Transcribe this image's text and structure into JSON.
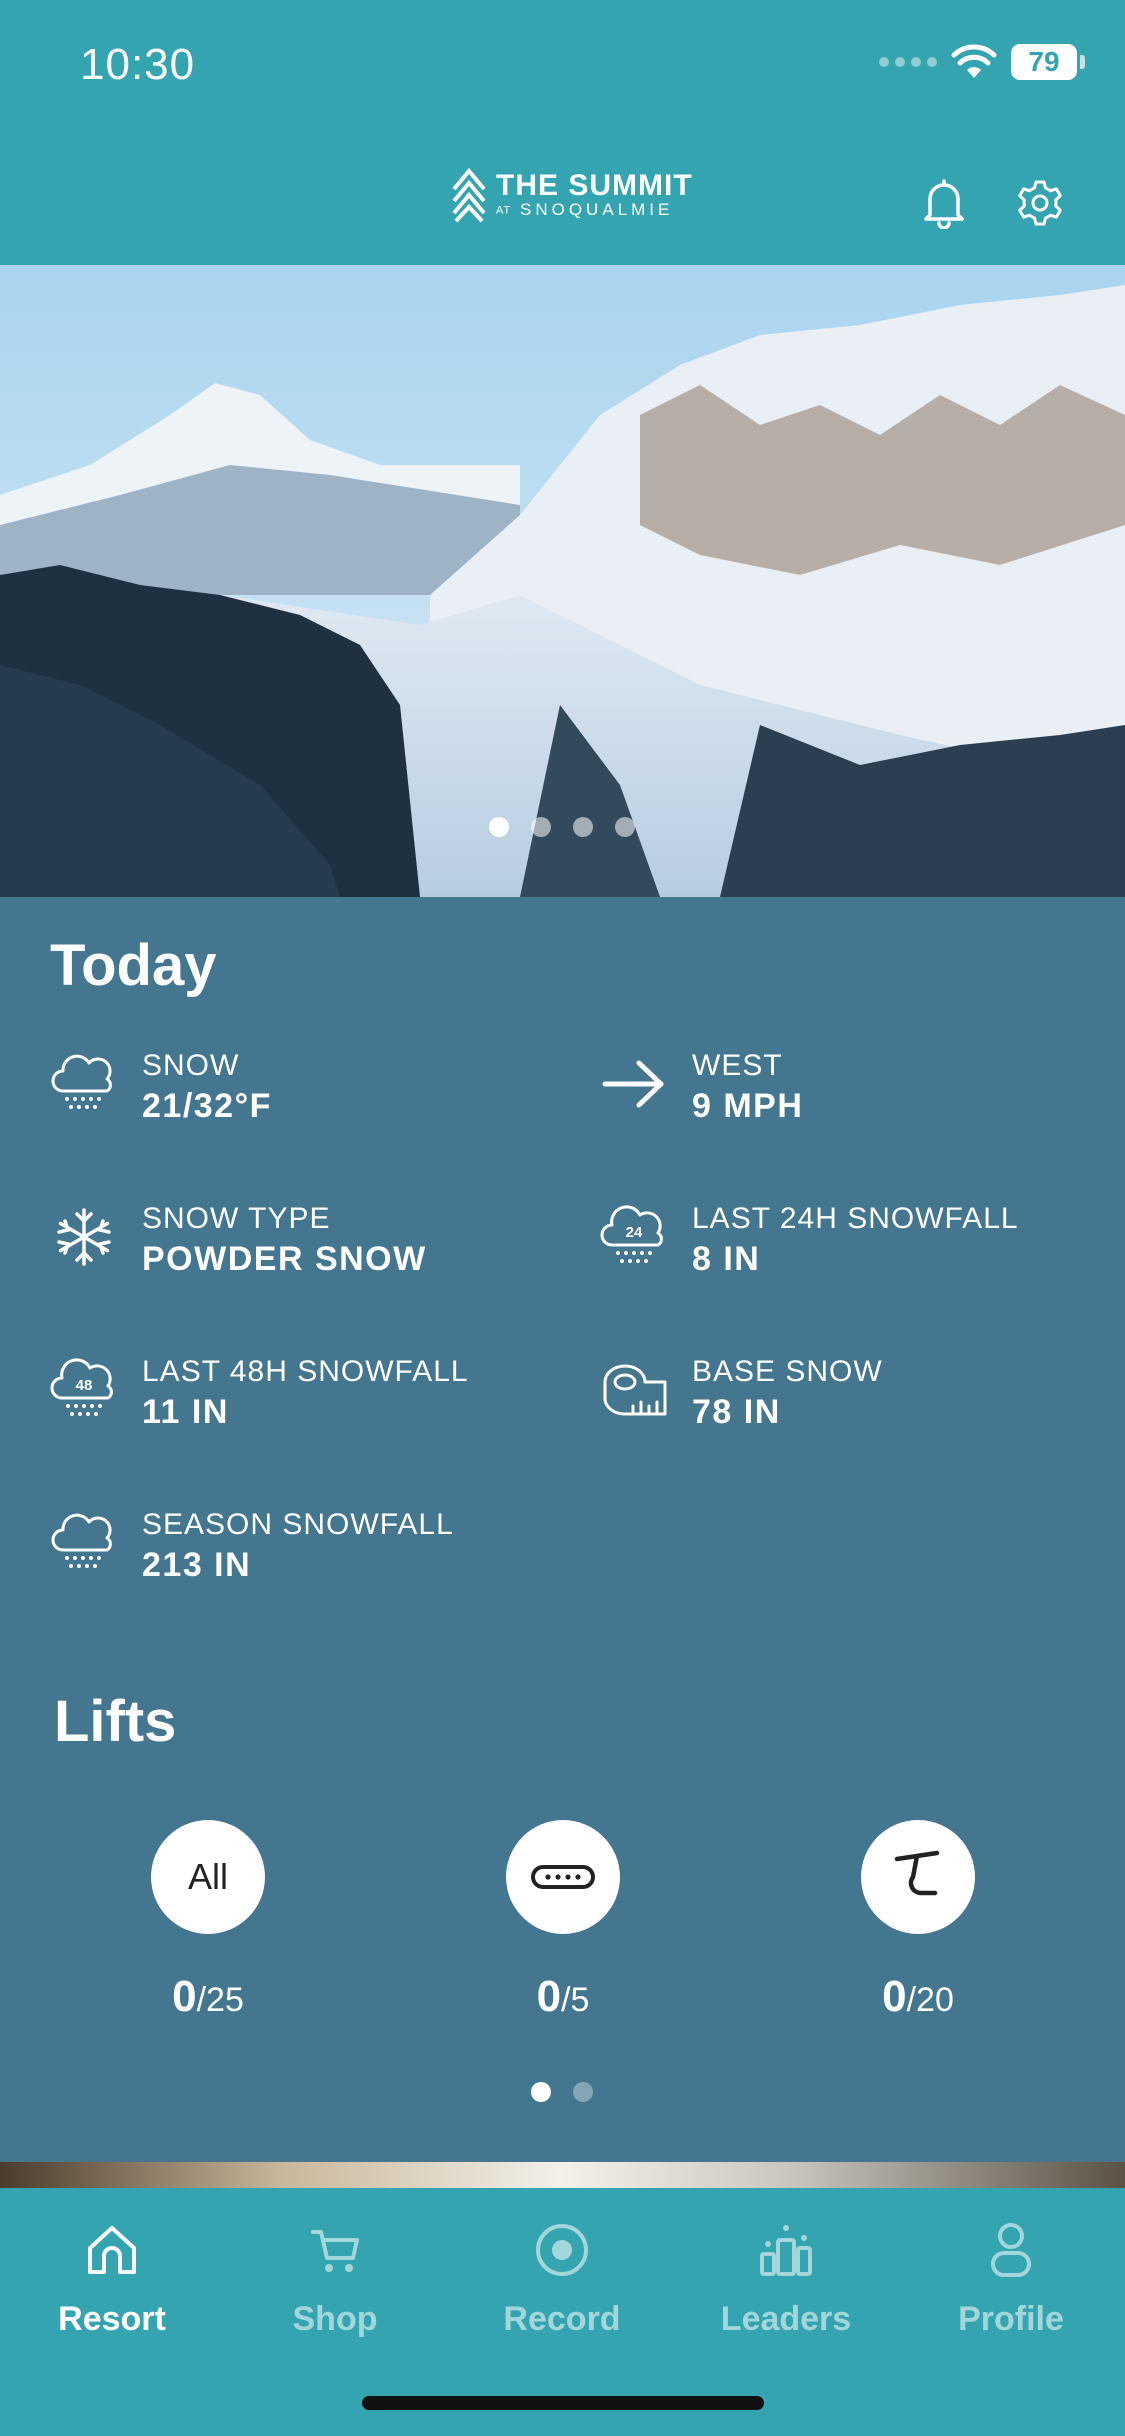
{
  "status_bar": {
    "time": "10:30",
    "battery": "79"
  },
  "header": {
    "logo_main": "THE SUMMIT",
    "logo_at": "AT",
    "logo_sub": "SNOQUALMIE",
    "icons": [
      "bell-icon",
      "gear-icon"
    ]
  },
  "hero": {
    "slide_count": 4,
    "active_slide": 1
  },
  "today": {
    "title": "Today",
    "items": [
      {
        "label": "SNOW",
        "value": "21/32°F",
        "icon": "snow-cloud-icon"
      },
      {
        "label": "WEST",
        "value": "9 MPH",
        "icon": "arrow-right-icon"
      },
      {
        "label": "SNOW TYPE",
        "value": "POWDER SNOW",
        "icon": "snowflake-icon"
      },
      {
        "label": "LAST 24H SNOWFALL",
        "value": "8 IN",
        "icon": "cloud-24-icon",
        "icon_text": "24"
      },
      {
        "label": "LAST 48H SNOWFALL",
        "value": "11 IN",
        "icon": "cloud-48-icon",
        "icon_text": "48"
      },
      {
        "label": "BASE SNOW",
        "value": "78 IN",
        "icon": "measuring-tape-icon"
      },
      {
        "label": "SEASON SNOWFALL",
        "value": "213 IN",
        "icon": "snow-cloud-icon"
      }
    ]
  },
  "lifts": {
    "title": "Lifts",
    "items": [
      {
        "badge": "All",
        "open": "0",
        "total": "/25",
        "icon": "all-lifts-icon"
      },
      {
        "badge": "",
        "open": "0",
        "total": "/5",
        "icon": "surface-lift-icon"
      },
      {
        "badge": "",
        "open": "0",
        "total": "/20",
        "icon": "chairlift-icon"
      }
    ],
    "page_count": 2,
    "active_page": 1
  },
  "tabbar": {
    "tabs": [
      {
        "label": "Resort",
        "icon": "home-icon",
        "active": true
      },
      {
        "label": "Shop",
        "icon": "cart-icon",
        "active": false
      },
      {
        "label": "Record",
        "icon": "record-icon",
        "active": false
      },
      {
        "label": "Leaders",
        "icon": "leaderboard-icon",
        "active": false
      },
      {
        "label": "Profile",
        "icon": "person-icon",
        "active": false
      }
    ]
  },
  "colors": {
    "header_teal": "#34a4b0",
    "body_blue": "#44768f",
    "text": "#ffffff"
  }
}
